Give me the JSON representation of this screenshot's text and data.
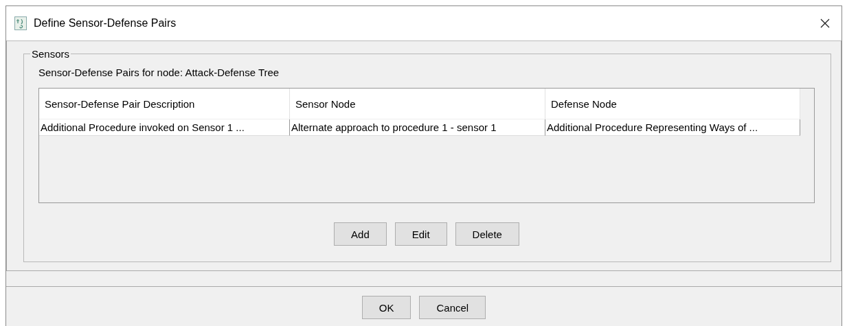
{
  "window": {
    "title": "Define Sensor-Defense Pairs"
  },
  "group": {
    "title": "Sensors",
    "caption": "Sensor-Defense Pairs for node: Attack-Defense Tree"
  },
  "table": {
    "columns": [
      "Sensor-Defense Pair Description",
      "Sensor Node",
      "Defense Node"
    ],
    "rows": [
      {
        "selected": false,
        "cells": [
          "Additional Procedure invoked on Sensor 1 ...",
          "Alternate approach to procedure 1 - sensor 1",
          "Additional Procedure Representing Ways of ..."
        ]
      }
    ]
  },
  "table_buttons": [
    "Add",
    "Edit",
    "Delete"
  ],
  "dialog_buttons": [
    "OK",
    "Cancel"
  ]
}
